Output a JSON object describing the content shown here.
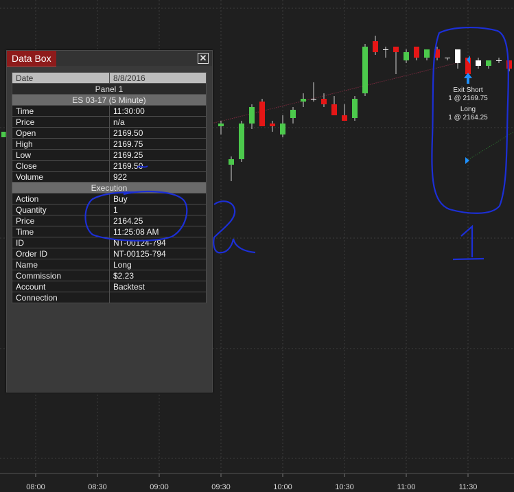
{
  "chart": {
    "x_ticks": [
      "08:00",
      "08:30",
      "09:00",
      "09:30",
      "10:00",
      "10:30",
      "11:00",
      "11:30"
    ],
    "candles": [
      {
        "o": 2167.5,
        "h": 2168.0,
        "l": 2166.75,
        "c": 2167.75,
        "color": "#4cc94c"
      },
      {
        "o": 2164.0,
        "h": 2164.75,
        "l": 2162.5,
        "c": 2164.5,
        "color": "#4cc94c"
      },
      {
        "o": 2164.5,
        "h": 2168.0,
        "l": 2164.25,
        "c": 2167.75,
        "color": "#4cc94c"
      },
      {
        "o": 2167.75,
        "h": 2169.5,
        "l": 2167.25,
        "c": 2169.25,
        "color": "#4cc94c"
      },
      {
        "o": 2169.75,
        "h": 2170.0,
        "l": 2167.5,
        "c": 2167.5,
        "color": "#e51616"
      },
      {
        "o": 2167.75,
        "h": 2168.0,
        "l": 2167.0,
        "c": 2167.5,
        "color": "#e51616"
      },
      {
        "o": 2166.75,
        "h": 2168.5,
        "l": 2166.5,
        "c": 2167.75,
        "color": "#4cc94c"
      },
      {
        "o": 2168.25,
        "h": 2169.25,
        "l": 2167.75,
        "c": 2169.0,
        "color": "#4cc94c"
      },
      {
        "o": 2169.75,
        "h": 2170.5,
        "l": 2169.25,
        "c": 2170.0,
        "color": "#4cc94c"
      },
      {
        "o": 2170.0,
        "h": 2171.5,
        "l": 2169.75,
        "c": 2170.0,
        "color": "#ffffff"
      },
      {
        "o": 2170.0,
        "h": 2170.5,
        "l": 2169.25,
        "c": 2169.5,
        "color": "#e51616"
      },
      {
        "o": 2169.5,
        "h": 2170.25,
        "l": 2168.5,
        "c": 2168.5,
        "color": "#e51616"
      },
      {
        "o": 2168.5,
        "h": 2169.5,
        "l": 2168.0,
        "c": 2168.0,
        "color": "#e51616"
      },
      {
        "o": 2168.25,
        "h": 2170.25,
        "l": 2168.0,
        "c": 2170.0,
        "color": "#4cc94c"
      },
      {
        "o": 2170.5,
        "h": 2175.0,
        "l": 2170.25,
        "c": 2174.75,
        "color": "#4cc94c"
      },
      {
        "o": 2175.25,
        "h": 2175.75,
        "l": 2174.0,
        "c": 2174.25,
        "color": "#e51616"
      },
      {
        "o": 2174.5,
        "h": 2174.75,
        "l": 2173.75,
        "c": 2174.5,
        "color": "#ffffff"
      },
      {
        "o": 2174.75,
        "h": 2174.75,
        "l": 2172.25,
        "c": 2174.25,
        "color": "#e51616"
      },
      {
        "o": 2173.5,
        "h": 2174.5,
        "l": 2173.25,
        "c": 2174.25,
        "color": "#4cc94c"
      },
      {
        "o": 2174.75,
        "h": 2174.75,
        "l": 2173.5,
        "c": 2173.75,
        "color": "#e51616"
      },
      {
        "o": 2173.75,
        "h": 2174.5,
        "l": 2173.5,
        "c": 2174.5,
        "color": "#4cc94c"
      },
      {
        "o": 2174.5,
        "h": 2174.75,
        "l": 2173.5,
        "c": 2173.75,
        "color": "#e51616"
      },
      {
        "o": 2173.75,
        "h": 2173.75,
        "l": 2173.5,
        "c": 2173.75,
        "color": "#ffffff"
      },
      {
        "o": 2174.5,
        "h": 2174.5,
        "l": 2172.75,
        "c": 2173.25,
        "color": "#ffffff"
      },
      {
        "o": 2173.75,
        "h": 2173.75,
        "l": 2172.25,
        "c": 2172.25,
        "color": "#e51616"
      },
      {
        "o": 2173.0,
        "h": 2173.75,
        "l": 2172.75,
        "c": 2173.5,
        "color": "#ffffff"
      },
      {
        "o": 2173.0,
        "h": 2173.5,
        "l": 2172.75,
        "c": 2173.5,
        "color": "#4cc94c"
      },
      {
        "o": 2173.5,
        "h": 2173.75,
        "l": 2173.25,
        "c": 2173.5,
        "color": "#ffffff"
      },
      {
        "o": 2173.5,
        "h": 2173.5,
        "l": 2172.5,
        "c": 2172.75,
        "color": "#e51616"
      },
      {
        "o": 2172.75,
        "h": 2173.0,
        "l": 2172.75,
        "c": 2172.75,
        "color": "#ffffff"
      }
    ],
    "trade_annotations": {
      "exit_label": "Exit Short",
      "exit_detail": "1 @ 2169.75",
      "entry_label": "Long",
      "entry_detail": "1 @ 2164.25"
    },
    "colors": {
      "up": "#4cc94c",
      "down": "#e51616",
      "background": "#1f1f1f",
      "grid": "#3a3a3a",
      "exit_arrow": "#1e90ff"
    }
  },
  "databox": {
    "title": "Data Box",
    "close_icon": "close-icon",
    "date_label": "Date",
    "date_value": "8/8/2016",
    "panel": "Panel 1",
    "instrument": "ES 03-17 (5 Minute)",
    "bar_rows": [
      {
        "label": "Time",
        "value": "11:30:00"
      },
      {
        "label": "Price",
        "value": "n/a"
      },
      {
        "label": "Open",
        "value": "2169.50"
      },
      {
        "label": "High",
        "value": "2169.75"
      },
      {
        "label": "Low",
        "value": "2169.25"
      },
      {
        "label": "Close",
        "value": "2169.50"
      },
      {
        "label": "Volume",
        "value": "922"
      }
    ],
    "execution_header": "Execution",
    "exec_rows": [
      {
        "label": "Action",
        "value": "Buy"
      },
      {
        "label": "Quantity",
        "value": "1"
      },
      {
        "label": "Price",
        "value": "2164.25"
      },
      {
        "label": "Time",
        "value": "11:25:08 AM"
      },
      {
        "label": "ID",
        "value": "NT-00124-794"
      },
      {
        "label": "Order ID",
        "value": "NT-00125-794"
      },
      {
        "label": "Name",
        "value": "Long"
      },
      {
        "label": "Commission",
        "value": "$2.23"
      },
      {
        "label": "Account",
        "value": "Backtest"
      },
      {
        "label": "Connection",
        "value": ""
      }
    ]
  },
  "handwriting": {
    "mark_1": "1",
    "mark_2": "2",
    "ink_color": "#1c2fd6"
  }
}
